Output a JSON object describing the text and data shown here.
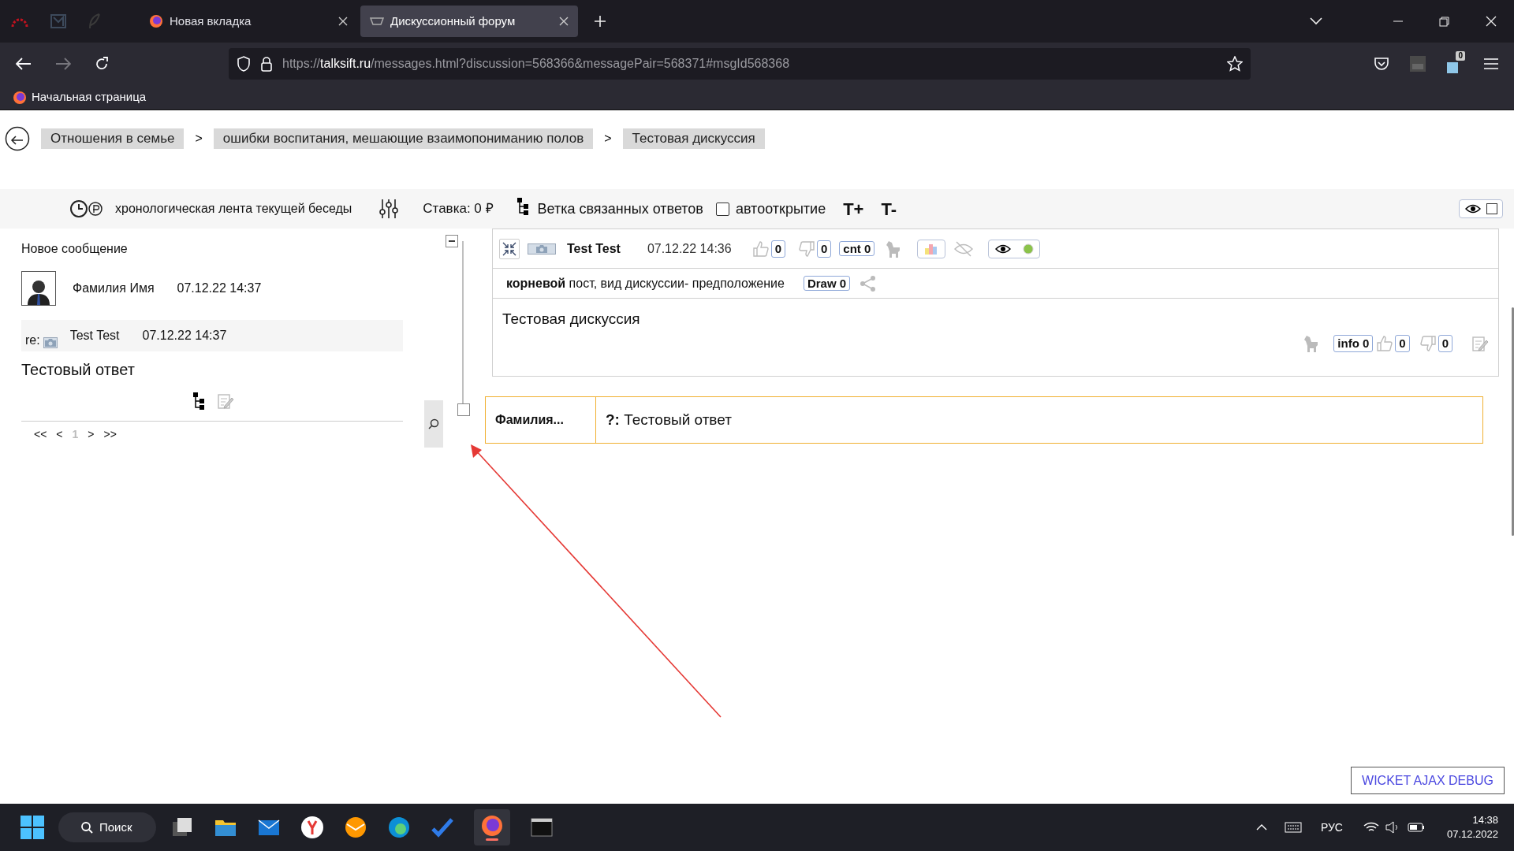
{
  "browser": {
    "tabs": [
      {
        "label": "Новая вкладка",
        "selected": false
      },
      {
        "label": "Дискуссионный форум",
        "selected": true
      }
    ],
    "url": {
      "host": "talksift.ru",
      "prefix": "https://",
      "path": "/messages.html?discussion=568366&messagePair=568371#msgId568368"
    },
    "extension_badge": "0",
    "bookmarks": [
      "Начальная страница"
    ]
  },
  "breadcrumbs": [
    "Отношения в семье",
    "ошибки воспитания, мешающие взаимопониманию полов",
    "Тестовая дискуссия"
  ],
  "breadcrumb_separator": ">",
  "toolbar": {
    "timeline": "хронологическая лента текущей беседы",
    "stake": "Ставка: 0 ₽",
    "branch": "Ветка связанных ответов",
    "autoopen": {
      "label": "автооткрытие",
      "checked": false
    },
    "text_bigger": "T+",
    "text_smaller": "T-",
    "view_checked": false
  },
  "left_panel": {
    "title": "Новое сообщение",
    "author": "Фамилия Имя",
    "author_time": "07.12.22 14:37",
    "re_label": "re:",
    "re_author": "Test Test",
    "re_time": "07.12.22 14:37",
    "message": "Тестовый ответ",
    "pager": [
      {
        "label": "<<",
        "selected": false
      },
      {
        "label": "<",
        "selected": false
      },
      {
        "label": "1",
        "selected": true
      },
      {
        "label": ">",
        "selected": false
      },
      {
        "label": ">>",
        "selected": false
      }
    ]
  },
  "post": {
    "author": "Test Test",
    "time": "07.12.22 14:36",
    "likes": "0",
    "dislikes": "0",
    "cnt": "cnt 0",
    "meta": "**корневой** пост, вид дискуссии- предположение",
    "draw": "Draw 0",
    "text": "Тестовая дискуссия",
    "info": "info 0",
    "chart_on": true,
    "status_on": true,
    "body_likes": "0",
    "body_dislikes": "0"
  },
  "reply": {
    "author": "Фамилия...",
    "text": "**?:** Тестовый ответ"
  },
  "debug_button": "WICKET AJAX DEBUG",
  "taskbar": {
    "search": "Поиск",
    "language": "РУС",
    "time": "14:38",
    "date": "07.12.2022"
  }
}
